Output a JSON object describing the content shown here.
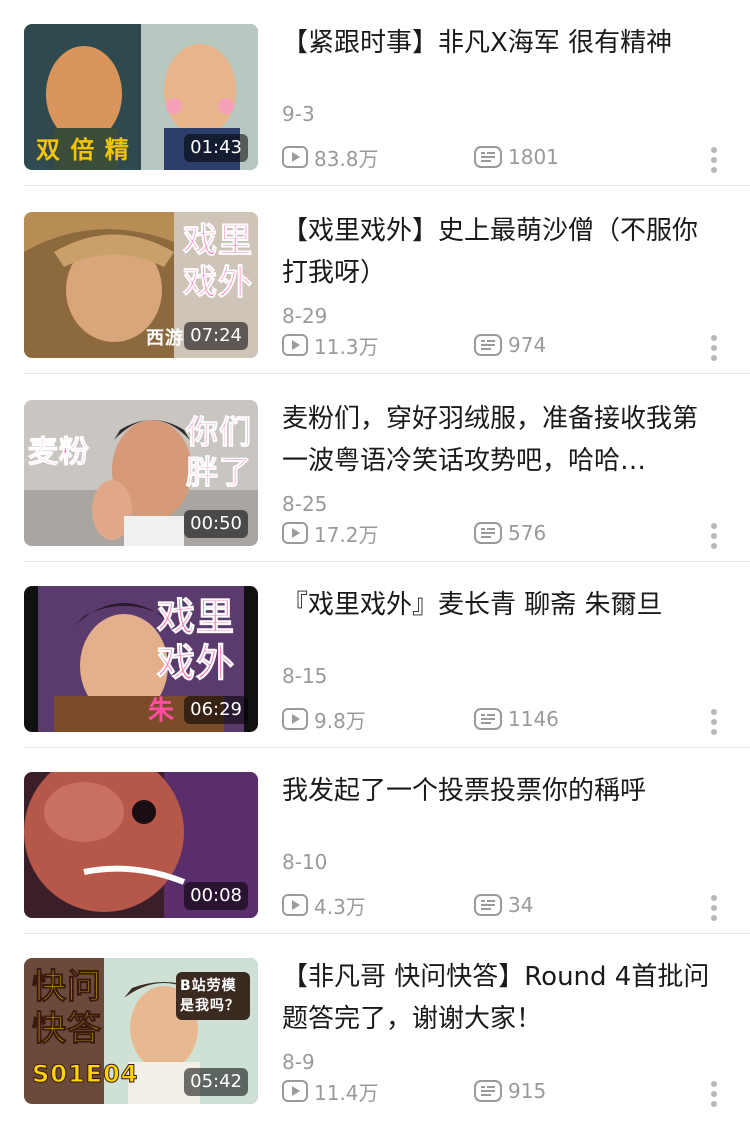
{
  "videos": [
    {
      "title": "【紧跟时事】非凡X海军  很有精神",
      "date": "9-3",
      "plays": "83.8万",
      "comments": "1801",
      "duration": "01:43",
      "thumb_caption": "双  倍  精",
      "thumb_caption_color": "#f5c400"
    },
    {
      "title": "【戏里戏外】史上最萌沙僧（不服你打我呀）",
      "date": "8-29",
      "plays": "11.3万",
      "comments": "974",
      "duration": "07:24",
      "thumb_caption": "戏里戏外",
      "thumb_caption_color": "#ff4fa0",
      "thumb_sub": "西游"
    },
    {
      "title": "麦粉们，穿好羽绒服，准备接收我第一波粤语冷笑话攻势吧，哈哈…",
      "date": "8-25",
      "plays": "17.2万",
      "comments": "576",
      "duration": "00:50",
      "thumb_caption_left": "麦粉",
      "thumb_caption_right": "你们胖了",
      "thumb_caption_color": "#ff4fa0"
    },
    {
      "title": "『戏里戏外』麦长青  聊斋  朱爾旦",
      "date": "8-15",
      "plays": "9.8万",
      "comments": "1146",
      "duration": "06:29",
      "thumb_caption": "戏里戏外",
      "thumb_caption_color": "#ff4fa0",
      "thumb_sub": "朱"
    },
    {
      "title": "我发起了一个投票投票你的稱呼",
      "date": "8-10",
      "plays": "4.3万",
      "comments": "34",
      "duration": "00:08"
    },
    {
      "title": "【非凡哥  快问快答】Round  4首批问题答完了，谢谢大家！",
      "date": "8-9",
      "plays": "11.4万",
      "comments": "915",
      "duration": "05:42",
      "thumb_caption": "快问快答",
      "thumb_caption_color": "#ffd400",
      "thumb_episode": "S01E04",
      "thumb_note": "B站劳模是我吗？"
    }
  ],
  "icons": {
    "plays": "play-icon",
    "comments": "danmaku-icon",
    "more": "more-icon"
  },
  "colors": {
    "text_primary": "#1a1a1a",
    "text_secondary": "#9a9a9a",
    "separator": "#e6e6e6"
  }
}
